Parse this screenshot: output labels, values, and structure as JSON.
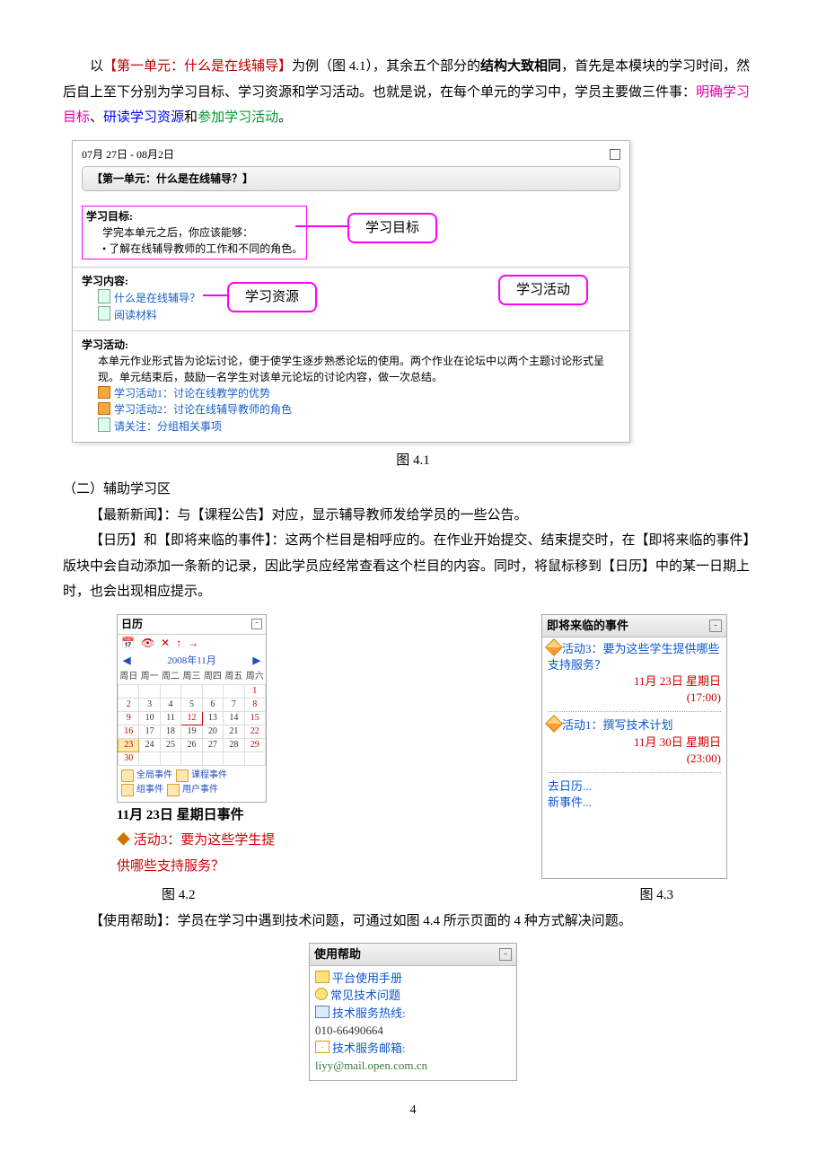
{
  "intro": {
    "prefix": "以",
    "unit_ref": "【第一单元：什么是在线辅导】",
    "after_ref": "为例（图 4.1），其余五个部分的",
    "bold1": "结构大致相同",
    "line1_tail": "，首先是本模块的学习时间，然后自上至下分别为学习目标、学习资源和学习活动。也就是说，在每个单元的学习中，学员主要做三件事：",
    "c1": "明确学习目标",
    "sep1": "、",
    "c2": "研读学习资源",
    "sep2": "和",
    "c3": "参加学习活动",
    "tail": "。"
  },
  "fig41": {
    "date_range": "07月 27日 - 08月2日",
    "title": "【第一单元：什么是在线辅导？】",
    "goal_label": "学习目标:",
    "goal_line1": "学完本单元之后，你应该能够：",
    "goal_line2": "• 了解在线辅导教师的工作和不同的角色。",
    "content_label": "学习内容:",
    "content_link1": "什么是在线辅导？",
    "content_link2": "阅读材料",
    "activity_label": "学习活动:",
    "activity_desc": "本单元作业形式皆为论坛讨论，便于使学生逐步熟悉论坛的使用。两个作业在论坛中以两个主题讨论形式呈现。单元结束后，鼓励一名学生对该单元论坛的讨论内容，做一次总结。",
    "activity_link1": "学习活动1：讨论在线教学的优势",
    "activity_link2": "学习活动2：讨论在线辅导教师的角色",
    "activity_link3": "请关注：分组相关事项",
    "callout_goal": "学习目标",
    "callout_res": "学习资源",
    "callout_act": "学习活动",
    "caption": "图 4.1"
  },
  "section2_title": "（二）辅助学习区",
  "p_news": "【最新新闻】：与【课程公告】对应，显示辅导教师发给学员的一些公告。",
  "p_cal": "【日历】和【即将来临的事件】：这两个栏目是相呼应的。在作业开始提交、结束提交时，在【即将来临的事件】版块中会自动添加一条新的记录，因此学员应经常查看这个栏目的内容。同时，将鼠标移到【日历】中的某一日期上时，也会出现相应提示。",
  "fig42": {
    "title": "日历",
    "icons": "📅 👁 ✕ ↑ →",
    "month": "2008年11月",
    "wk": [
      "周日",
      "周一",
      "周二",
      "周三",
      "周四",
      "周五",
      "周六"
    ],
    "rows": [
      [
        "",
        "",
        "",
        "",
        "",
        "",
        "1"
      ],
      [
        "2",
        "3",
        "4",
        "5",
        "6",
        "7",
        "8"
      ],
      [
        "9",
        "10",
        "11",
        "12",
        "13",
        "14",
        "15"
      ],
      [
        "16",
        "17",
        "18",
        "19",
        "20",
        "21",
        "22"
      ],
      [
        "23",
        "24",
        "25",
        "26",
        "27",
        "28",
        "29"
      ],
      [
        "30",
        "",
        "",
        "",
        "",
        "",
        ""
      ]
    ],
    "tooltip_title": "11月 23日 星期日事件",
    "tooltip_body": "活动3：要为这些学生提供哪些支持服务？",
    "legend1a": "全局事件",
    "legend1b": "课程事件",
    "legend2a": "组事件",
    "legend2b": "用户事件",
    "caption": "图 4.2"
  },
  "fig43": {
    "title": "即将来临的事件",
    "ev1_title": "活动3：要为这些学生提供哪些支持服务？",
    "ev1_date1": "11月 23日 星期日",
    "ev1_date2": "(17:00)",
    "ev2_title": "活动1：撰写技术计划",
    "ev2_date1": "11月 30日 星期日",
    "ev2_date2": "(23:00)",
    "link1": "去日历...",
    "link2": "新事件...",
    "caption": "图 4.3"
  },
  "p_help": "【使用帮助】：学员在学习中遇到技术问题，可通过如图 4.4 所示页面的 4 种方式解决问题。",
  "fig44": {
    "title": "使用帮助",
    "l1": "平台使用手册",
    "l2": "常见技术问题",
    "l3": "技术服务热线:",
    "phone": "010-66490664",
    "l4": "技术服务邮箱:",
    "email": "liyy@mail.open.com.cn"
  },
  "page_no": "4"
}
